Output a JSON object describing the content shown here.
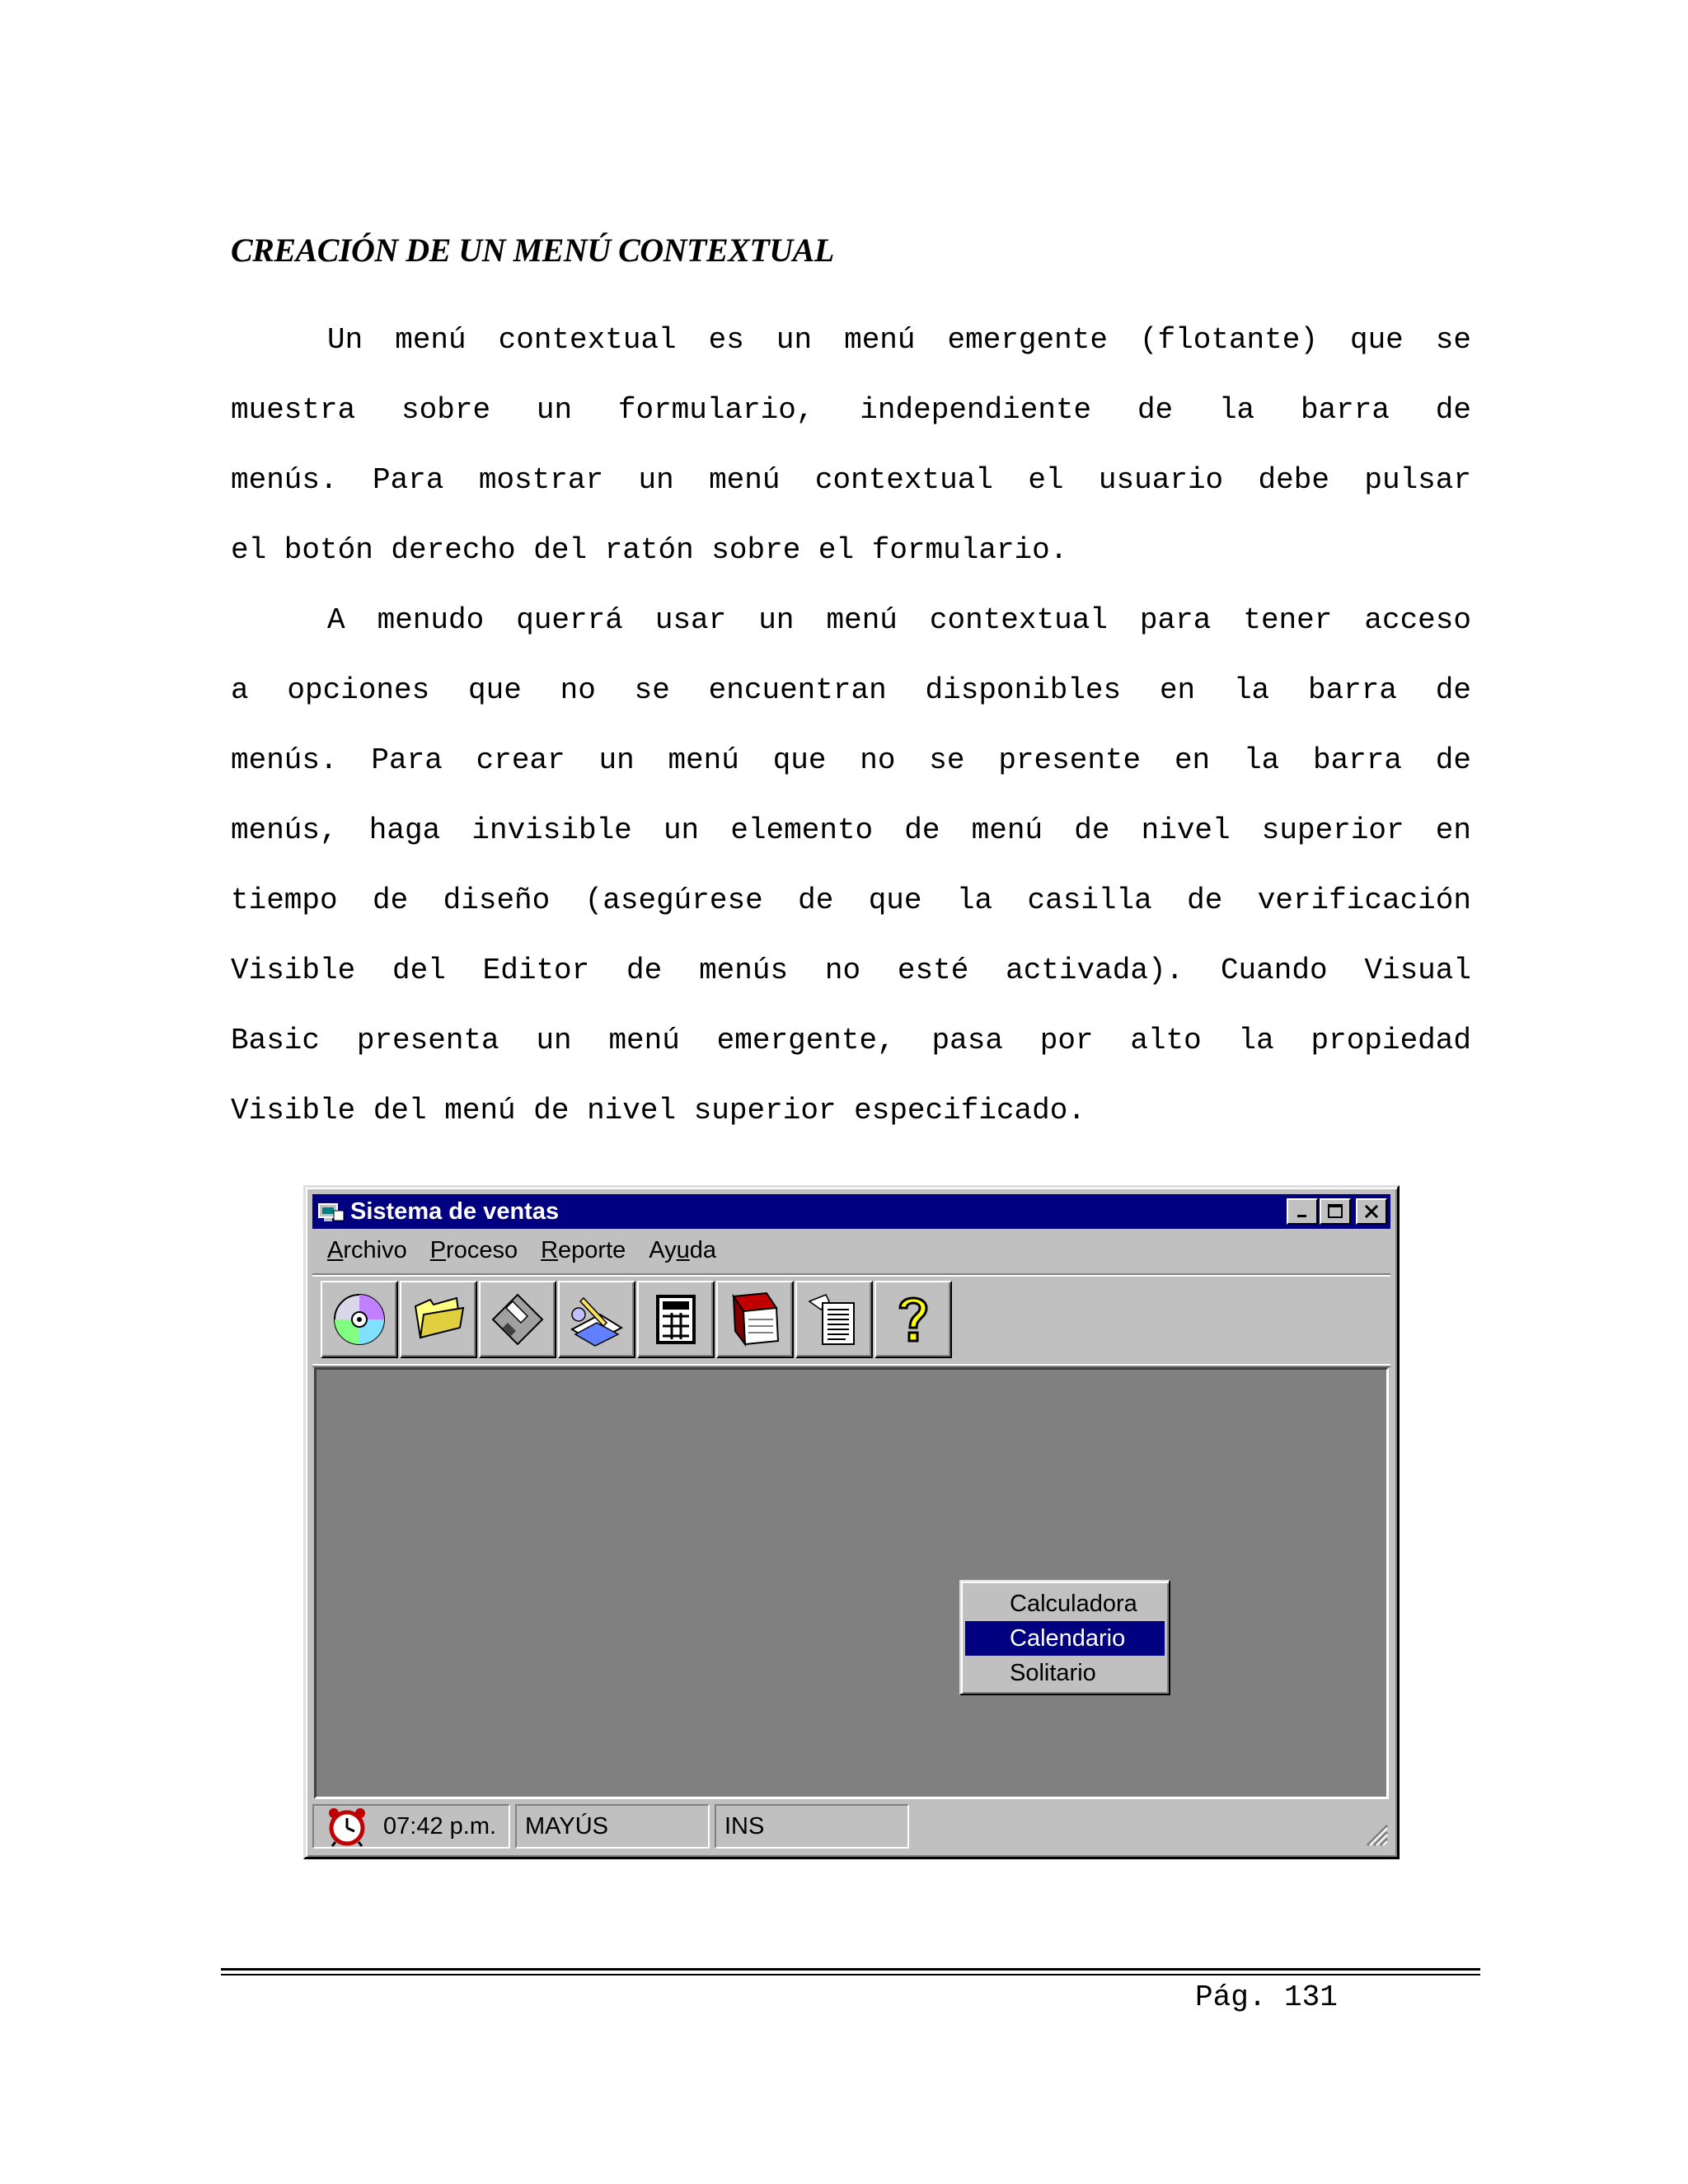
{
  "document": {
    "heading": "CREACIÓN DE UN MENÚ CONTEXTUAL",
    "lines": [
      "Un menú contextual es un menú emergente (flotante) que se",
      "muestra sobre un formulario, independiente de la barra de",
      "menús. Para mostrar un menú contextual el usuario debe pulsar",
      "el botón derecho del ratón sobre el formulario.",
      "A menudo querrá usar un menú contextual para tener acceso",
      "a opciones que no se encuentran disponibles en la barra de",
      "menús. Para crear un menú que no se presente en la barra de",
      "menús, haga invisible un elemento de menú de nivel superior en",
      "tiempo de diseño (asegúrese de que la casilla de verificación",
      "Visible del Editor de menús no esté activada). Cuando Visual",
      "Basic presenta un menú emergente, pasa por alto la propiedad",
      "Visible del menú de nivel superior especificado."
    ],
    "page_number": "Pág. 131"
  },
  "window": {
    "title": "Sistema de ventas",
    "menus": [
      {
        "key": "A",
        "rest": "rchivo"
      },
      {
        "key": "P",
        "rest": "roceso"
      },
      {
        "key": "R",
        "rest": "eporte"
      },
      {
        "pre": "Ay",
        "key": "u",
        "rest": "da"
      }
    ],
    "toolbar_icons": [
      "cd-icon",
      "folder-icon",
      "floppy-icon",
      "writing-icon",
      "calculator-icon",
      "notebook-icon",
      "document-icon",
      "help-icon"
    ],
    "context_menu": {
      "items": [
        "Calculadora",
        "Calendario",
        "Solitario"
      ],
      "selected_index": 1
    },
    "status": {
      "time": "07:42 p.m.",
      "caps": "MAYÚS",
      "ins": "INS"
    },
    "colors": {
      "face": "#c0c0c0",
      "titlebar": "#000080",
      "client": "#808080",
      "highlight": "#000080"
    }
  }
}
